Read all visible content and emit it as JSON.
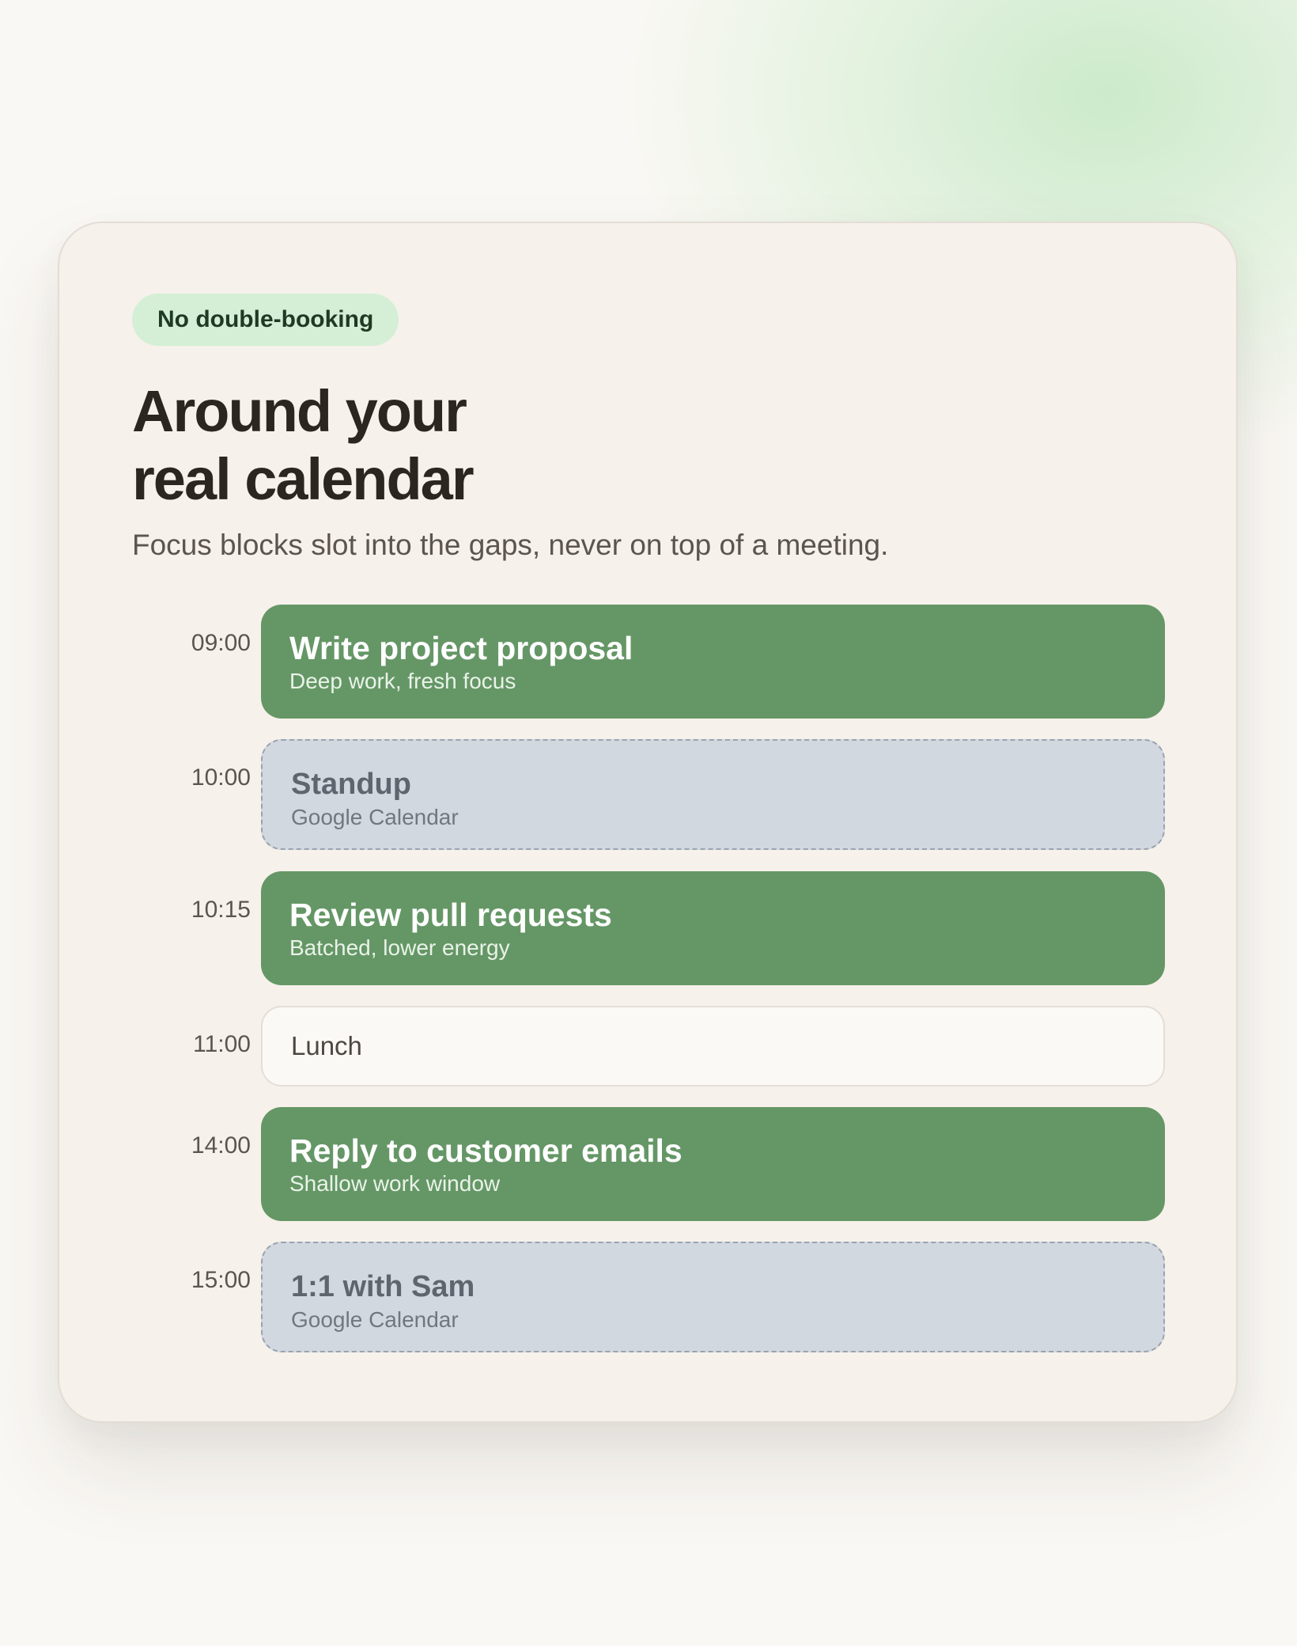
{
  "badge": "No double-booking",
  "heading": {
    "line1": "Around your",
    "line2": "real calendar"
  },
  "subtitle": "Focus blocks slot into the gaps, never on top of a meeting.",
  "schedule": [
    {
      "time": "09:00",
      "type": "task",
      "title": "Write project proposal",
      "subtitle": "Deep work, fresh focus"
    },
    {
      "time": "10:00",
      "type": "meeting",
      "title": "Standup",
      "subtitle": "Google Calendar"
    },
    {
      "time": "10:15",
      "type": "task",
      "title": "Review pull requests",
      "subtitle": "Batched, lower energy"
    },
    {
      "time": "11:00",
      "type": "plain",
      "title": "Lunch"
    },
    {
      "time": "14:00",
      "type": "task",
      "title": "Reply to customer emails",
      "subtitle": "Shallow work window"
    },
    {
      "time": "15:00",
      "type": "meeting",
      "title": "1:1 with Sam",
      "subtitle": "Google Calendar"
    }
  ],
  "colors": {
    "task": "#659766",
    "meeting": "#d2d8e0",
    "plain": "#fbf9f6",
    "badge": "#d4efd5",
    "card": "#f6f1eb"
  }
}
